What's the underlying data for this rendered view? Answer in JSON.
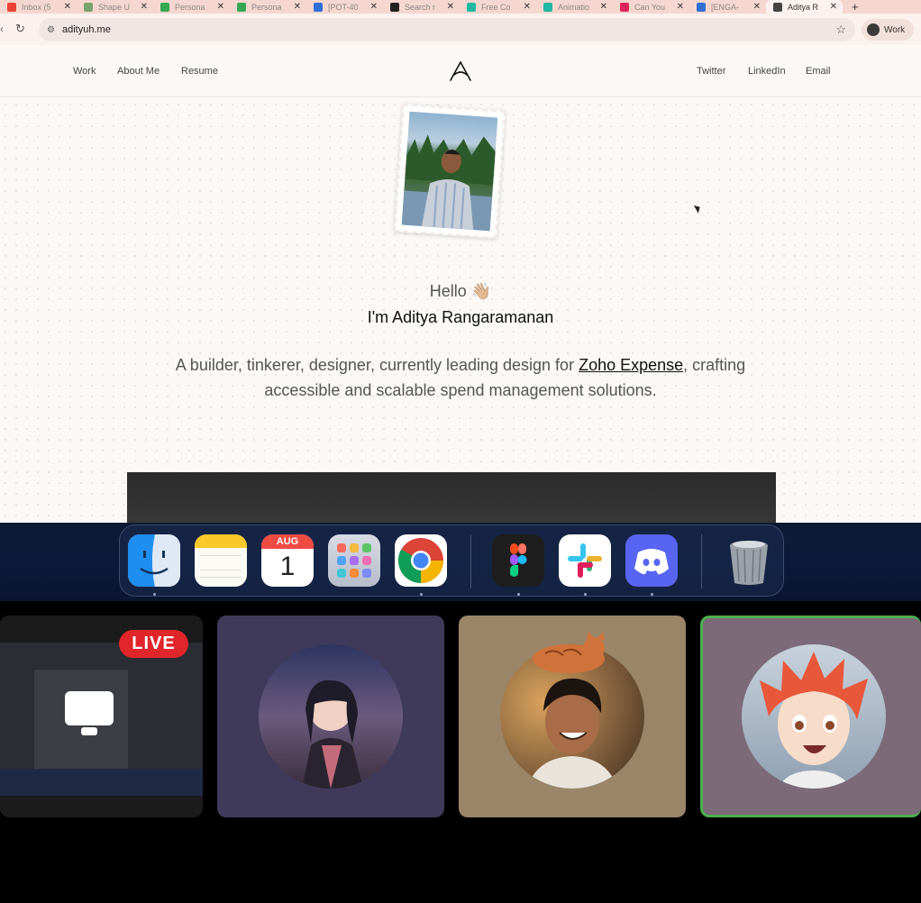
{
  "browser": {
    "tabs": [
      {
        "title": "Inbox (5",
        "color": "#ea4335"
      },
      {
        "title": "Shape U",
        "color": "#7aa46f"
      },
      {
        "title": "Persona",
        "color": "#34a853"
      },
      {
        "title": "Persona",
        "color": "#34a853"
      },
      {
        "title": "[POT-40",
        "color": "#2f6fd6"
      },
      {
        "title": "Search r",
        "color": "#222222"
      },
      {
        "title": "Free Co",
        "color": "#1fb8a2"
      },
      {
        "title": "Animatio",
        "color": "#1fb8a2"
      },
      {
        "title": "Can You",
        "color": "#e0245e"
      },
      {
        "title": "[ENGA-",
        "color": "#2f6fd6"
      },
      {
        "title": "Aditya R",
        "color": "#444444",
        "active": true
      }
    ],
    "url": "adityuh.me",
    "profile_label": "Work"
  },
  "site": {
    "nav_left": [
      "Work",
      "About Me",
      "Resume"
    ],
    "nav_right": [
      "Twitter",
      "LinkedIn",
      "Email"
    ],
    "hello": "Hello 👋🏼",
    "name": "I'm Aditya Rangaramanan",
    "bio_before": "A builder, tinkerer, designer, currently leading design for ",
    "bio_link": "Zoho Expense",
    "bio_after": ", crafting accessible and scalable spend management solutions."
  },
  "dock": {
    "apps": [
      "finder-icon",
      "notes-icon",
      "calendar-icon",
      "launchpad-icon",
      "chrome-icon",
      "figma-icon",
      "slack-icon",
      "discord-icon",
      "trash-icon"
    ],
    "calendar_month": "AUG",
    "calendar_day": "1"
  },
  "call": {
    "live_label": "LIVE",
    "tile_colors": [
      "#1b1b1b",
      "#3f3a5a",
      "#9a8568",
      "#7c6a78"
    ],
    "active_speaker_color": "#4caf50"
  }
}
